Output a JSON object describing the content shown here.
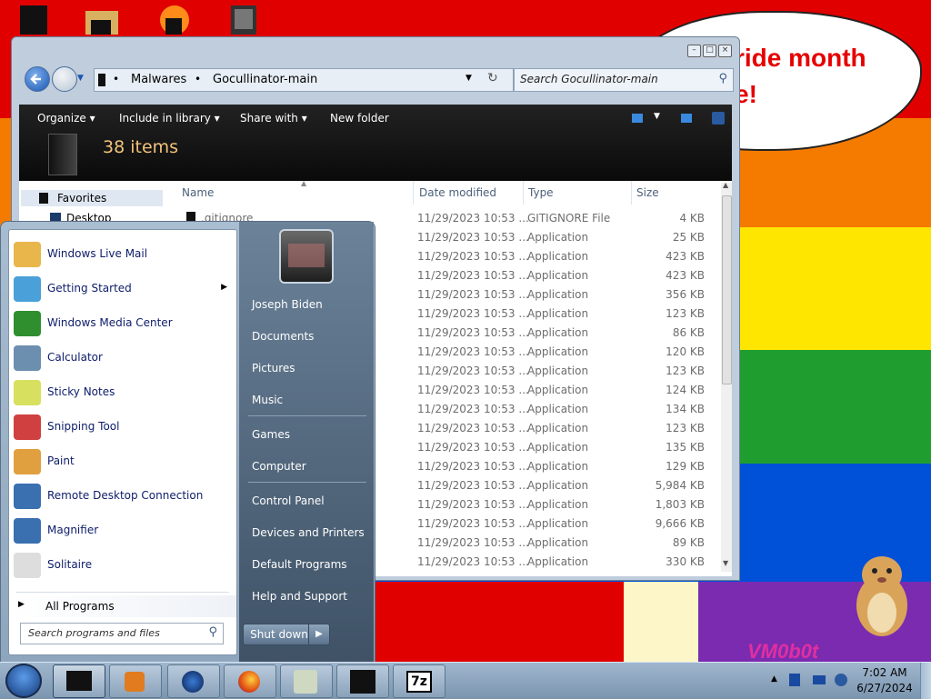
{
  "desktop": {
    "stripes": [
      "#e00000",
      "#f57a00",
      "#ffe600",
      "#1f9e2f",
      "#0050d8",
      "#7b2bb0"
    ],
    "bubble_lines": [
      "ride month",
      "e!"
    ],
    "watermark": "VM0b0t"
  },
  "explorer": {
    "breadcrumb": [
      "Malwares",
      "Gocullinator-main"
    ],
    "search_placeholder": "Search Gocullinator-main",
    "toolbar": {
      "organize": "Organize",
      "include_in_library": "Include in library",
      "share_with": "Share with",
      "new_folder": "New folder"
    },
    "items_count": "38 items",
    "nav_pane": {
      "favorites": "Favorites",
      "desktop": "Desktop"
    },
    "columns": {
      "name": "Name",
      "date_modified": "Date modified",
      "type": "Type",
      "size": "Size"
    },
    "rows": [
      {
        "name": ".gitignore",
        "date": "11/29/2023 10:53 ...",
        "type": "GITIGNORE File",
        "size": "4 KB"
      },
      {
        "name": "",
        "date": "11/29/2023 10:53 ...",
        "type": "Application",
        "size": "25 KB"
      },
      {
        "name": "",
        "date": "11/29/2023 10:53 ...",
        "type": "Application",
        "size": "423 KB"
      },
      {
        "name": "",
        "date": "11/29/2023 10:53 ...",
        "type": "Application",
        "size": "423 KB"
      },
      {
        "name": "",
        "date": "11/29/2023 10:53 ...",
        "type": "Application",
        "size": "356 KB"
      },
      {
        "name": "",
        "date": "11/29/2023 10:53 ...",
        "type": "Application",
        "size": "123 KB"
      },
      {
        "name": "",
        "date": "11/29/2023 10:53 ...",
        "type": "Application",
        "size": "86 KB"
      },
      {
        "name": "",
        "date": "11/29/2023 10:53 ...",
        "type": "Application",
        "size": "120 KB"
      },
      {
        "name": "",
        "date": "11/29/2023 10:53 ...",
        "type": "Application",
        "size": "123 KB"
      },
      {
        "name": "",
        "date": "11/29/2023 10:53 ...",
        "type": "Application",
        "size": "124 KB"
      },
      {
        "name": "",
        "date": "11/29/2023 10:53 ...",
        "type": "Application",
        "size": "134 KB"
      },
      {
        "name": "",
        "date": "11/29/2023 10:53 ...",
        "type": "Application",
        "size": "123 KB"
      },
      {
        "name": "",
        "date": "11/29/2023 10:53 ...",
        "type": "Application",
        "size": "135 KB"
      },
      {
        "name": "",
        "date": "11/29/2023 10:53 ...",
        "type": "Application",
        "size": "129 KB"
      },
      {
        "name": "",
        "date": "11/29/2023 10:53 ...",
        "type": "Application",
        "size": "5,984 KB"
      },
      {
        "name": "",
        "date": "11/29/2023 10:53 ...",
        "type": "Application",
        "size": "1,803 KB"
      },
      {
        "name": "",
        "date": "11/29/2023 10:53 ...",
        "type": "Application",
        "size": "9,666 KB"
      },
      {
        "name": "",
        "date": "11/29/2023 10:53 ...",
        "type": "Application",
        "size": "89 KB"
      },
      {
        "name": "",
        "date": "11/29/2023 10:53 ...",
        "type": "Application",
        "size": "330 KB"
      }
    ]
  },
  "start_menu": {
    "programs": [
      {
        "label": "Windows Live Mail",
        "icon": "mail-icon",
        "color": "#e8b64a"
      },
      {
        "label": "Getting Started",
        "icon": "getting-started-icon",
        "color": "#4aa0d8"
      },
      {
        "label": "Windows Media Center",
        "icon": "windows-logo-icon",
        "color": "#2f8f2f"
      },
      {
        "label": "Calculator",
        "icon": "calculator-icon",
        "color": "#6c8fb0"
      },
      {
        "label": "Sticky Notes",
        "icon": "sticky-notes-icon",
        "color": "#d8e060"
      },
      {
        "label": "Snipping Tool",
        "icon": "scissors-icon",
        "color": "#d04040"
      },
      {
        "label": "Paint",
        "icon": "paint-palette-icon",
        "color": "#e0a040"
      },
      {
        "label": "Remote Desktop Connection",
        "icon": "remote-desktop-icon",
        "color": "#3a6fb0"
      },
      {
        "label": "Magnifier",
        "icon": "magnifier-icon",
        "color": "#3a6fb0"
      },
      {
        "label": "Solitaire",
        "icon": "cards-icon",
        "color": "#dddddd"
      }
    ],
    "all_programs": "All Programs",
    "search_placeholder": "Search programs and files",
    "right_items": [
      "Joseph Biden",
      "Documents",
      "Pictures",
      "Music",
      "Games",
      "Computer",
      "Control Panel",
      "Devices and Printers",
      "Default Programs",
      "Help and Support"
    ],
    "shutdown": "Shut down"
  },
  "taskbar": {
    "time": "7:02 AM",
    "date": "6/27/2024",
    "pinned": [
      "explorer-icon",
      "media-player-icon",
      "ie-icon",
      "firefox-icon",
      "hamster-icon",
      "cmd-icon",
      "7zip-icon"
    ],
    "seven_zip_label": "7z"
  }
}
